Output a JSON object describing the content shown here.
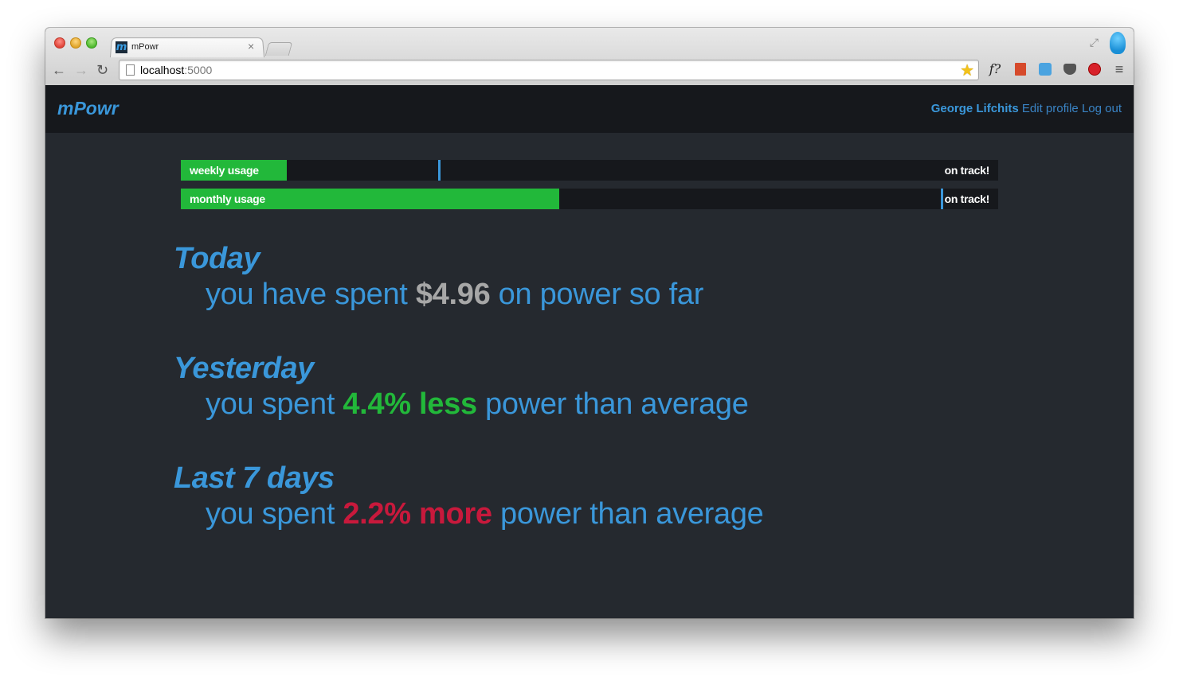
{
  "browser": {
    "tab_title": "mPowr",
    "tab_close": "×",
    "favicon_letter": "m",
    "url_host": "localhost",
    "url_port": ":5000",
    "ext_f_label": "f?",
    "menu_glyph": "≡",
    "fullscreen_glyph": "⤢",
    "star_glyph": "★",
    "back_glyph": "←",
    "forward_glyph": "→",
    "reload_glyph": "↻"
  },
  "navbar": {
    "brand": "mPowr",
    "user_name": "George Lifchits",
    "edit_profile": "Edit profile",
    "log_out": "Log out"
  },
  "usage": {
    "weekly": {
      "label": "weekly usage",
      "status": "on track!",
      "fill_fraction": 0.13,
      "marker_fraction": 0.315
    },
    "monthly": {
      "label": "monthly usage",
      "status": "on track!",
      "fill_fraction": 0.463,
      "marker_fraction": 0.93
    }
  },
  "stats": {
    "today": {
      "heading": "Today",
      "prefix": "you have spent ",
      "value": "$4.96",
      "suffix": " on power so far"
    },
    "yesterday": {
      "heading": "Yesterday",
      "prefix": "you spent ",
      "value": "4.4% less",
      "suffix": " power than average"
    },
    "last7": {
      "heading": "Last 7 days",
      "prefix": "you spent ",
      "value": "2.2% more",
      "suffix": " power than average"
    }
  },
  "colors": {
    "accent": "#3a97da",
    "good": "#22b83a",
    "bad": "#c8193c",
    "neutral": "#a7a7a7",
    "background": "#25292f",
    "navbar": "#16181c"
  }
}
